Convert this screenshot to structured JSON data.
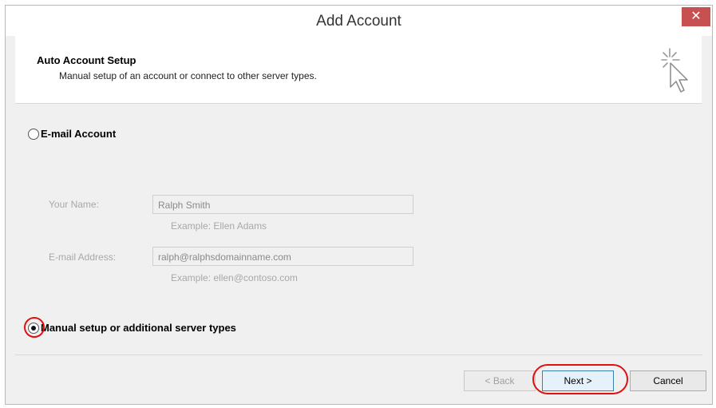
{
  "window": {
    "title": "Add Account",
    "close_label": "✕"
  },
  "header": {
    "title": "Auto Account Setup",
    "subtitle": "Manual setup of an account or connect to other server types."
  },
  "options": {
    "email_account_label": "E-mail Account",
    "manual_setup_label": "Manual setup or additional server types",
    "selected": "manual_setup"
  },
  "fields": {
    "name_label": "Your Name:",
    "name_value": "Ralph Smith",
    "name_example": "Example: Ellen Adams",
    "email_label": "E-mail Address:",
    "email_value": "ralph@ralphsdomainname.com",
    "email_example": "Example: ellen@contoso.com"
  },
  "buttons": {
    "back": "< Back",
    "next": "Next >",
    "cancel": "Cancel"
  },
  "colors": {
    "close_bg": "#c75050",
    "highlight_ring": "#e01010"
  }
}
